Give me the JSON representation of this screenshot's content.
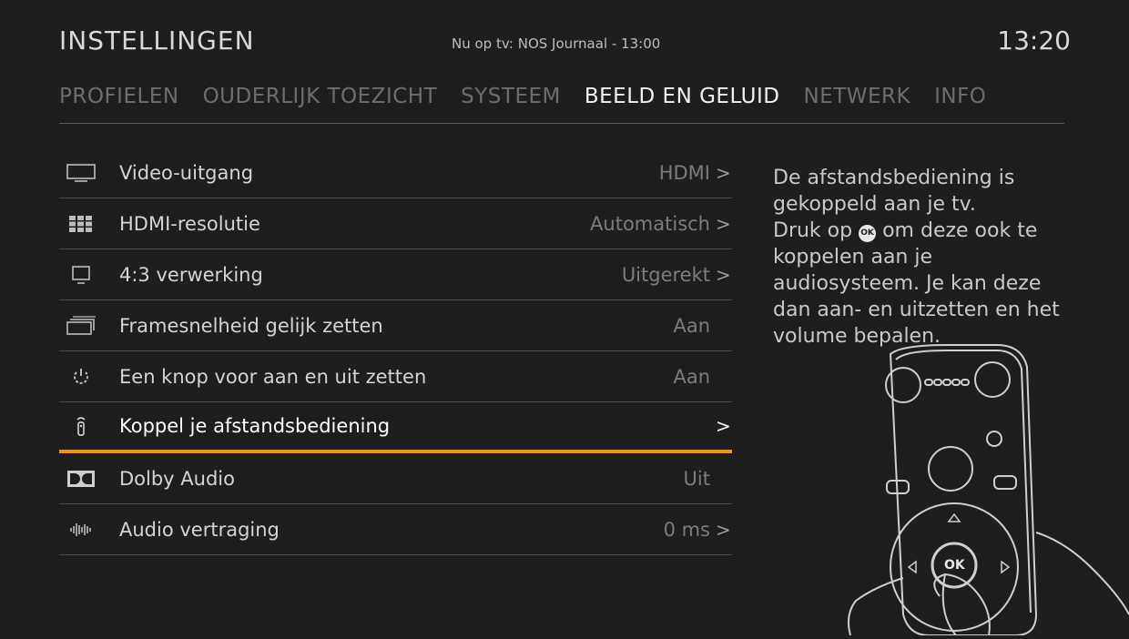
{
  "header": {
    "title": "INSTELLINGEN",
    "now_playing": "Nu op tv: NOS Journaal - 13:00",
    "clock": "13:20"
  },
  "tabs": [
    {
      "label": "PROFIELEN",
      "active": false
    },
    {
      "label": "OUDERLIJK TOEZICHT",
      "active": false
    },
    {
      "label": "SYSTEEM",
      "active": false
    },
    {
      "label": "BEELD EN GELUID",
      "active": true
    },
    {
      "label": "NETWERK",
      "active": false
    },
    {
      "label": "INFO",
      "active": false
    }
  ],
  "settings": [
    {
      "icon": "monitor-icon",
      "label": "Video-uitgang",
      "value": "HDMI",
      "chevron": ">"
    },
    {
      "icon": "grid-icon",
      "label": "HDMI-resolutie",
      "value": "Automatisch",
      "chevron": ">"
    },
    {
      "icon": "small-screen-icon",
      "label": "4:3 verwerking",
      "value": "Uitgerekt",
      "chevron": ">"
    },
    {
      "icon": "frames-icon",
      "label": "Framesnelheid gelijk zetten",
      "value": "Aan",
      "chevron": ""
    },
    {
      "icon": "power-icon",
      "label": "Een knop voor aan en uit zetten",
      "value": "Aan",
      "chevron": ""
    },
    {
      "icon": "remote-icon",
      "label": "Koppel je afstandsbediening",
      "value": "",
      "chevron": ">"
    },
    {
      "icon": "dolby-icon",
      "label": "Dolby Audio",
      "value": "Uit",
      "chevron": ""
    },
    {
      "icon": "waveform-icon",
      "label": "Audio vertraging",
      "value": "0 ms",
      "chevron": ">"
    }
  ],
  "info_panel": {
    "line1": "De afstandsbediening is gekoppeld aan je tv.",
    "line2_before": "Druk op",
    "ok_badge": "OK",
    "line2_after": "om deze ook te koppelen aan je audiosysteem. Je kan deze dan aan- en uitzetten en het volume bepalen."
  },
  "illustration": {
    "ok_label": "OK"
  },
  "colors": {
    "background": "#1e1e1e",
    "accent": "#f19021",
    "active_text": "#f2f2f2",
    "inactive_tab": "#6d6d6d"
  }
}
